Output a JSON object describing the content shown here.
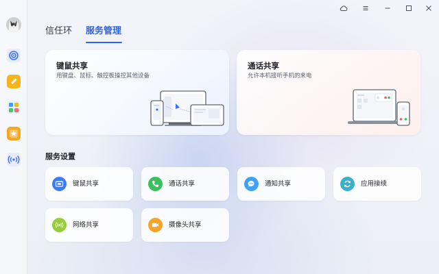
{
  "tabs": [
    {
      "label": "信任环",
      "active": false
    },
    {
      "label": "服务管理",
      "active": true
    }
  ],
  "feature_cards": [
    {
      "title": "键鼠共享",
      "subtitle": "用键盘、鼠标、触控板操控其他设备"
    },
    {
      "title": "通话共享",
      "subtitle": "允许本机接听手机的来电"
    }
  ],
  "section": {
    "title": "服务设置"
  },
  "services": [
    {
      "label": "键鼠共享",
      "icon": "keyboard-mouse-icon",
      "color": "#3f7cf2"
    },
    {
      "label": "通话共享",
      "icon": "phone-icon",
      "color": "#3cbf5e"
    },
    {
      "label": "通知共享",
      "icon": "message-icon",
      "color": "#3fa2f0"
    },
    {
      "label": "应用接续",
      "icon": "continuity-icon",
      "color": "#39b1c8"
    },
    {
      "label": "网络共享",
      "icon": "network-icon",
      "color": "#97cc3c"
    },
    {
      "label": "摄像头共享",
      "icon": "camera-icon",
      "color": "#f5a429"
    }
  ],
  "sidebar": {
    "items": [
      {
        "icon": "avatar-cat"
      },
      {
        "icon": "sync-rings-icon",
        "color": "#3d6ef5"
      },
      {
        "icon": "pencil-icon",
        "color": "#f4b41a"
      },
      {
        "icon": "apps-grid-icon",
        "color": "#3aa0f5"
      },
      {
        "icon": "star-icon",
        "color": "#f6a623"
      },
      {
        "icon": "wireless-icon",
        "color": "#3d6ef5"
      }
    ]
  },
  "titlebar": {
    "buttons": [
      "cloud-icon",
      "menu-icon",
      "minimize-icon",
      "maximize-icon",
      "close-icon"
    ]
  }
}
